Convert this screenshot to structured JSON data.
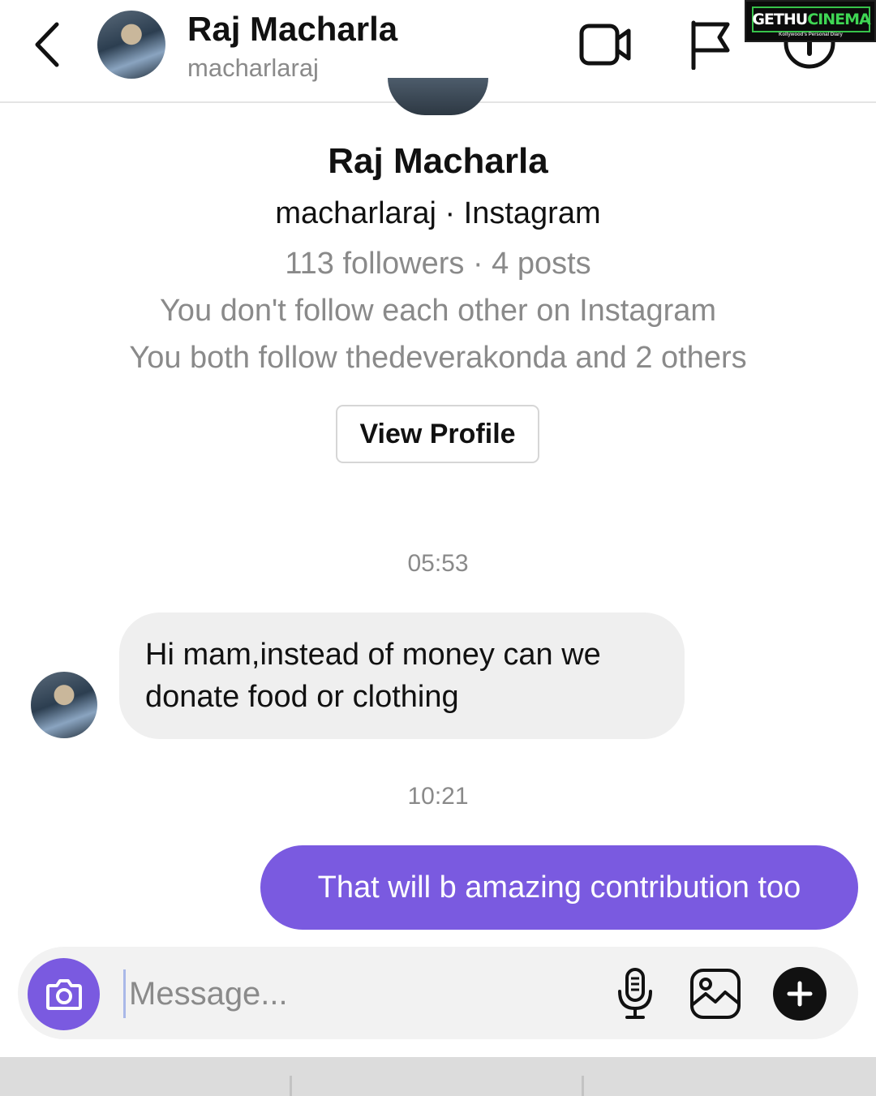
{
  "header": {
    "name": "Raj Macharla",
    "handle": "macharlaraj"
  },
  "watermark": {
    "brand_a": "GETHU",
    "brand_b": "CINEMA",
    "tagline": "Kollywood's Personal Diary"
  },
  "profile": {
    "name": "Raj Macharla",
    "subtitle": "macharlaraj · Instagram",
    "stats": "113 followers · 4 posts",
    "follow_status": "You don't follow each other on Instagram",
    "mutuals": "You both follow thedeverakonda and 2 others",
    "view_profile_label": "View Profile"
  },
  "messages": [
    {
      "timestamp": "05:53",
      "direction": "incoming",
      "text": "Hi mam,instead of money can we donate food or clothing"
    },
    {
      "timestamp": "10:21",
      "direction": "outgoing",
      "text": "That will b amazing contribution too"
    }
  ],
  "composer": {
    "placeholder": "Message..."
  },
  "icons": [
    "back-chevron-icon",
    "video-call-icon",
    "flag-icon",
    "info-icon",
    "camera-icon",
    "microphone-icon",
    "gallery-icon",
    "plus-icon"
  ],
  "colors": {
    "accent": "#7a5ae0",
    "incoming_bubble": "#efefef",
    "muted_text": "#8a8a8a"
  }
}
